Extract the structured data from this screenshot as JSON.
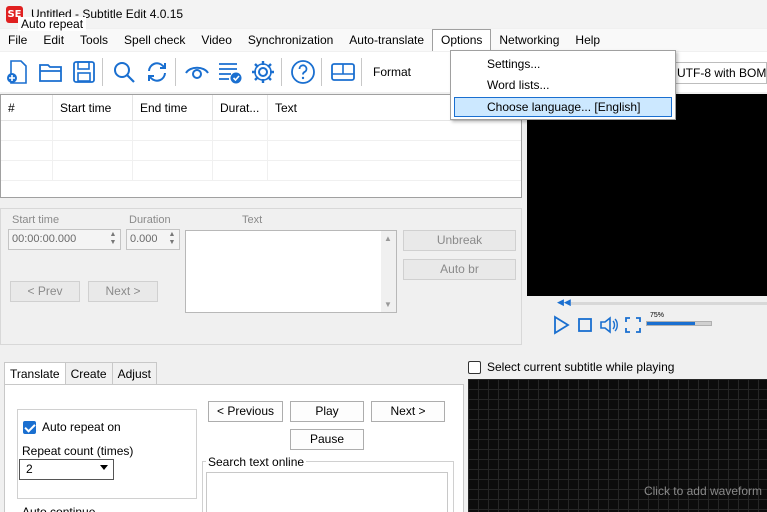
{
  "window": {
    "title": "Untitled - Subtitle Edit 4.0.15",
    "logo": "SE"
  },
  "menubar": {
    "items": [
      "File",
      "Edit",
      "Tools",
      "Spell check",
      "Video",
      "Synchronization",
      "Auto-translate",
      "Options",
      "Networking",
      "Help"
    ]
  },
  "options_menu": {
    "items": [
      "Settings...",
      "Word lists...",
      "Choose language... [English]"
    ],
    "highlighted_index": 2
  },
  "toolbar": {
    "icons": [
      "new-file-icon",
      "open-folder-icon",
      "save-icon",
      "find-icon",
      "replace-icon",
      "visual-sync-icon",
      "spell-check-icon",
      "settings-icon",
      "help-icon",
      "layout-icon"
    ],
    "format_label": "Format",
    "encoding_value": "UTF-8 with BOM"
  },
  "grid": {
    "headers": [
      "#",
      "Start time",
      "End time",
      "Durat...",
      "Text"
    ]
  },
  "edit_panel": {
    "start_time_label": "Start time",
    "start_time_value": "00:00:00.000",
    "duration_label": "Duration",
    "duration_value": "0.000",
    "text_label": "Text",
    "unbreak_label": "Unbreak",
    "auto_br_label": "Auto br",
    "prev_label": "< Prev",
    "next_label": "Next >"
  },
  "video": {
    "select_current_label": "Select current subtitle while playing",
    "volume_level": 0.75,
    "volume_text": "75%"
  },
  "tabs": {
    "items": [
      "Translate",
      "Create",
      "Adjust"
    ],
    "active_index": 0
  },
  "translate": {
    "auto_repeat_group": "Auto repeat",
    "auto_repeat_on_label": "Auto repeat on",
    "auto_repeat_on": true,
    "repeat_count_label": "Repeat count (times)",
    "repeat_count_value": "2",
    "previous_label": "< Previous",
    "play_label": "Play",
    "next_label": "Next >",
    "pause_label": "Pause",
    "search_online_label": "Search text online",
    "auto_continue_label": "Auto continue"
  },
  "waveform": {
    "hint": "Click to add waveform"
  },
  "colors": {
    "accent": "#1a6fd0",
    "highlight": "#cce8ff",
    "logo": "#e02020"
  }
}
